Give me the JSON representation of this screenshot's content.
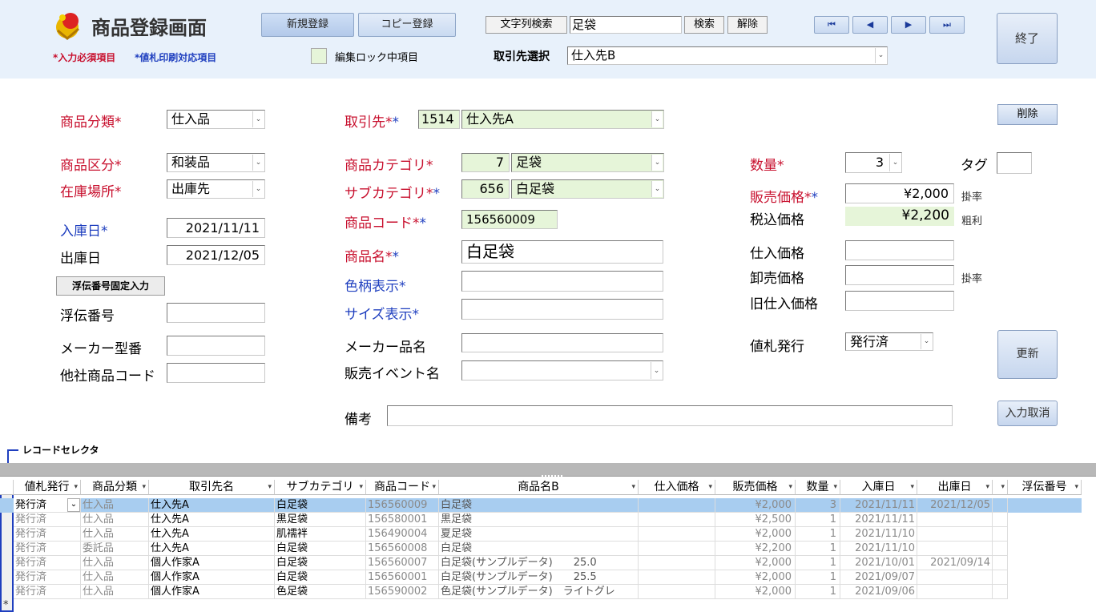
{
  "header": {
    "title": "商品登録画面",
    "required_note": "*入力必須項目",
    "print_note": "*値札印刷対応項目",
    "new_btn": "新規登録",
    "copy_btn": "コピー登録",
    "lock_note": "編集ロック中項目",
    "search_btn": "文字列検索",
    "search_value": "足袋",
    "find_btn": "検索",
    "clear_btn": "解除",
    "supplier_label": "取引先選択",
    "supplier_value": "仕入先B",
    "exit_btn": "終了",
    "nav": [
      "⏮",
      "◀",
      "▶",
      "⏭"
    ]
  },
  "form": {
    "delete_btn": "削除",
    "update_btn": "更新",
    "cancel_btn": "入力取消",
    "slip_fixed_btn": "浮伝番号固定入力",
    "category_label": "商品分類",
    "category_value": "仕入品",
    "kind_label": "商品区分",
    "kind_value": "和装品",
    "location_label": "在庫場所",
    "location_value": "出庫先",
    "in_date_label": "入庫日",
    "in_date_value": "2021/11/11",
    "out_date_label": "出庫日",
    "out_date_value": "2021/12/05",
    "slip_label": "浮伝番号",
    "maker_no_label": "メーカー型番",
    "other_code_label": "他社商品コード",
    "partner_label": "取引先",
    "partner_code": "1514",
    "partner_name": "仕入先A",
    "pcat_label": "商品カテゴリ",
    "pcat_code": "7",
    "pcat_name": "足袋",
    "scat_label": "サブカテゴリ",
    "scat_code": "656",
    "scat_name": "白足袋",
    "code_label": "商品コード",
    "code_value": "156560009",
    "name_label": "商品名",
    "name_value": "白足袋",
    "color_label": "色柄表示",
    "size_label": "サイズ表示",
    "maker_name_label": "メーカー品名",
    "event_label": "販売イベント名",
    "qty_label": "数量",
    "qty_value": "3",
    "tag_label": "タグ",
    "price_label": "販売価格",
    "price_value": "¥2,000",
    "rate1": "掛率",
    "tax_label": "税込価格",
    "tax_value": "¥2,200",
    "margin": "粗利",
    "cost_label": "仕入価格",
    "wholesale_label": "卸売価格",
    "rate2": "掛率",
    "old_cost_label": "旧仕入価格",
    "tagissue_label": "値札発行",
    "tagissue_value": "発行済",
    "memo_label": "備考",
    "star": "*"
  },
  "record_selector": "レコードセレクタ",
  "grid": {
    "headers": [
      "値札発行",
      "商品分類",
      "取引先名",
      "サブカテゴリ",
      "商品コード",
      "商品名B",
      "仕入価格",
      "販売価格",
      "数量",
      "入庫日",
      "出庫日",
      "",
      "浮伝番号"
    ],
    "rows": [
      [
        "発行済",
        "仕入品",
        "仕入先A",
        "白足袋",
        "156560009",
        "白足袋",
        "",
        "¥2,000",
        "3",
        "2021/11/11",
        "2021/12/05",
        ""
      ],
      [
        "発行済",
        "仕入品",
        "仕入先A",
        "黒足袋",
        "156580001",
        "黒足袋",
        "",
        "¥2,500",
        "1",
        "2021/11/11",
        "",
        ""
      ],
      [
        "発行済",
        "仕入品",
        "仕入先A",
        "肌襦袢",
        "156490004",
        "夏足袋",
        "",
        "¥2,000",
        "1",
        "2021/11/10",
        "",
        ""
      ],
      [
        "発行済",
        "委託品",
        "仕入先A",
        "白足袋",
        "156560008",
        "白足袋",
        "",
        "¥2,200",
        "1",
        "2021/11/10",
        "",
        ""
      ],
      [
        "発行済",
        "仕入品",
        "個人作家A",
        "白足袋",
        "156560007",
        "白足袋(サンプルデータ)　　25.0",
        "",
        "¥2,000",
        "1",
        "2021/10/01",
        "2021/09/14",
        ""
      ],
      [
        "発行済",
        "仕入品",
        "個人作家A",
        "白足袋",
        "156560001",
        "白足袋(サンプルデータ)　　25.5",
        "",
        "¥2,000",
        "1",
        "2021/09/07",
        "",
        ""
      ],
      [
        "発行済",
        "仕入品",
        "個人作家A",
        "色足袋",
        "156590002",
        "色足袋(サンプルデータ)　ライトグレ",
        "",
        "¥2,000",
        "1",
        "2021/09/06",
        "",
        ""
      ]
    ],
    "new_row_marker": "*"
  },
  "colors": {
    "header_bg": "#e8f1fb",
    "required": "#c8102e",
    "print": "#1f3fbf",
    "locked": "#e6f5d9",
    "selected_row": "#a8cdf0"
  }
}
